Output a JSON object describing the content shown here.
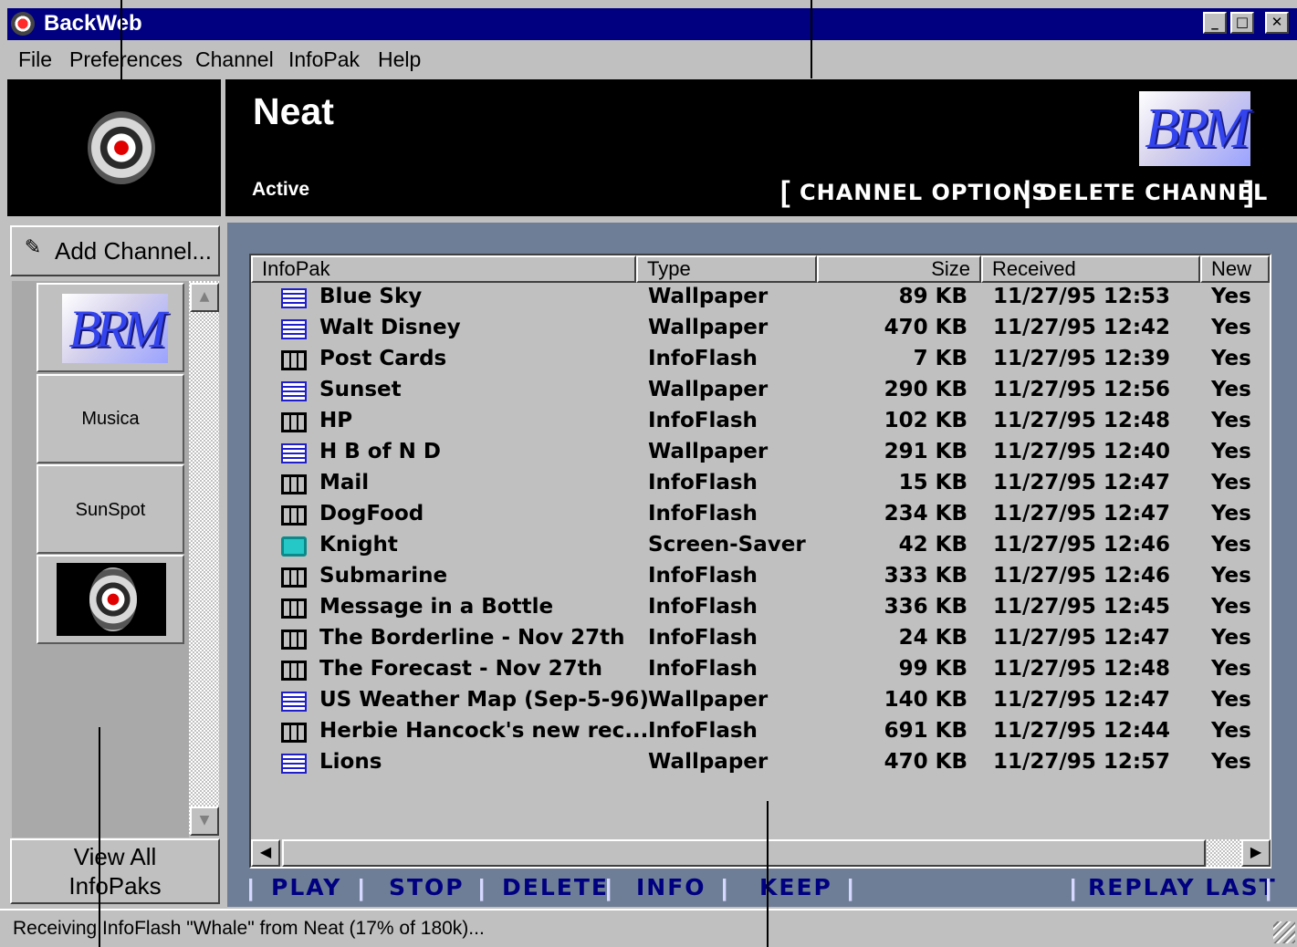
{
  "window": {
    "title": "BackWeb",
    "controls": {
      "minimize": "_",
      "maximize": "□",
      "close": "✕"
    }
  },
  "menu": [
    "File",
    "Preferences",
    "Channel",
    "InfoPak",
    "Help"
  ],
  "header": {
    "channel_name": "Neat",
    "status": "Active",
    "channel_logo_text": "BRM",
    "options_label": "CHANNEL OPTIONS",
    "delete_label": "DELETE CHANNEL"
  },
  "sidebar": {
    "add_channel_label": "Add Channel...",
    "channels": [
      {
        "kind": "logo",
        "art_text": "BRM",
        "selected": true
      },
      {
        "kind": "text",
        "label": "Musica"
      },
      {
        "kind": "text",
        "label": "SunSpot"
      },
      {
        "kind": "logo",
        "art": "backweb-logo"
      }
    ],
    "view_all_line1": "View All",
    "view_all_line2": "InfoPaks"
  },
  "table": {
    "columns": [
      "InfoPak",
      "Type",
      "Size",
      "Received",
      "New"
    ],
    "rows": [
      {
        "icon": "wallpaper-icon",
        "name": "Blue Sky",
        "type": "Wallpaper",
        "size": "89 KB",
        "received": "11/27/95 12:53",
        "new": "Yes"
      },
      {
        "icon": "wallpaper-icon",
        "name": "Walt Disney",
        "type": "Wallpaper",
        "size": "470 KB",
        "received": "11/27/95 12:42",
        "new": "Yes"
      },
      {
        "icon": "infoflash-icon",
        "name": "Post Cards",
        "type": "InfoFlash",
        "size": "7 KB",
        "received": "11/27/95 12:39",
        "new": "Yes"
      },
      {
        "icon": "wallpaper-icon",
        "name": "Sunset",
        "type": "Wallpaper",
        "size": "290 KB",
        "received": "11/27/95 12:56",
        "new": "Yes"
      },
      {
        "icon": "infoflash-icon",
        "name": "HP",
        "type": "InfoFlash",
        "size": "102 KB",
        "received": "11/27/95 12:48",
        "new": "Yes"
      },
      {
        "icon": "wallpaper-icon",
        "name": "H B of N  D",
        "type": "Wallpaper",
        "size": "291 KB",
        "received": "11/27/95 12:40",
        "new": "Yes"
      },
      {
        "icon": "infoflash-icon",
        "name": "Mail",
        "type": "InfoFlash",
        "size": "15 KB",
        "received": "11/27/95 12:47",
        "new": "Yes"
      },
      {
        "icon": "infoflash-icon",
        "name": "DogFood",
        "type": "InfoFlash",
        "size": "234 KB",
        "received": "11/27/95 12:47",
        "new": "Yes"
      },
      {
        "icon": "screensaver-icon",
        "name": "Knight",
        "type": "Screen-Saver",
        "size": "42 KB",
        "received": "11/27/95 12:46",
        "new": "Yes"
      },
      {
        "icon": "infoflash-icon",
        "name": "Submarine",
        "type": "InfoFlash",
        "size": "333 KB",
        "received": "11/27/95 12:46",
        "new": "Yes"
      },
      {
        "icon": "infoflash-icon",
        "name": "Message in a Bottle",
        "type": "InfoFlash",
        "size": "336 KB",
        "received": "11/27/95 12:45",
        "new": "Yes"
      },
      {
        "icon": "infoflash-icon",
        "name": "The Borderline - Nov 27th",
        "type": "InfoFlash",
        "size": "24 KB",
        "received": "11/27/95 12:47",
        "new": "Yes"
      },
      {
        "icon": "infoflash-icon",
        "name": "The Forecast - Nov 27th",
        "type": "InfoFlash",
        "size": "99 KB",
        "received": "11/27/95 12:48",
        "new": "Yes"
      },
      {
        "icon": "wallpaper-icon",
        "name": "US Weather Map (Sep-5-96)",
        "type": "Wallpaper",
        "size": "140 KB",
        "received": "11/27/95 12:47",
        "new": "Yes"
      },
      {
        "icon": "infoflash-icon",
        "name": "Herbie Hancock's new rec...",
        "type": "InfoFlash",
        "size": "691 KB",
        "received": "11/27/95 12:44",
        "new": "Yes"
      },
      {
        "icon": "wallpaper-icon",
        "name": "Lions",
        "type": "Wallpaper",
        "size": "470 KB",
        "received": "11/27/95 12:57",
        "new": "Yes"
      }
    ]
  },
  "actions": [
    "PLAY",
    "STOP",
    "DELETE",
    "INFO",
    "KEEP",
    "REPLAY LAST"
  ],
  "status_bar": "Receiving InfoFlash \"Whale\" from Neat (17% of 180k)...",
  "colors": {
    "title_bar": "#000080",
    "content_background": "#6e7e96",
    "action_text": "#000080",
    "wallpaper_icon": "#1e1ecc",
    "screensaver_icon": "#26c7c7"
  }
}
